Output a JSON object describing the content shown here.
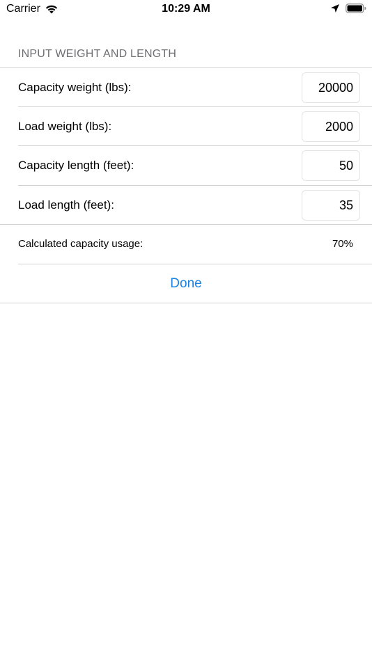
{
  "status_bar": {
    "carrier": "Carrier",
    "time": "10:29 AM",
    "icons": [
      "wifi-icon",
      "location-icon",
      "battery-icon"
    ]
  },
  "form": {
    "section_header": "INPUT WEIGHT AND LENGTH",
    "fields": [
      {
        "label": "Capacity weight (lbs):",
        "value": "20000"
      },
      {
        "label": "Load weight (lbs):",
        "value": "2000"
      },
      {
        "label": "Capacity length (feet):",
        "value": "50"
      },
      {
        "label": "Load length (feet):",
        "value": "35"
      }
    ],
    "result": {
      "label": "Calculated capacity usage:",
      "value": "70%"
    },
    "done_label": "Done"
  },
  "colors": {
    "accent": "#1a82e0",
    "section_header": "#6d6d72",
    "separator": "#d1d1d6"
  }
}
